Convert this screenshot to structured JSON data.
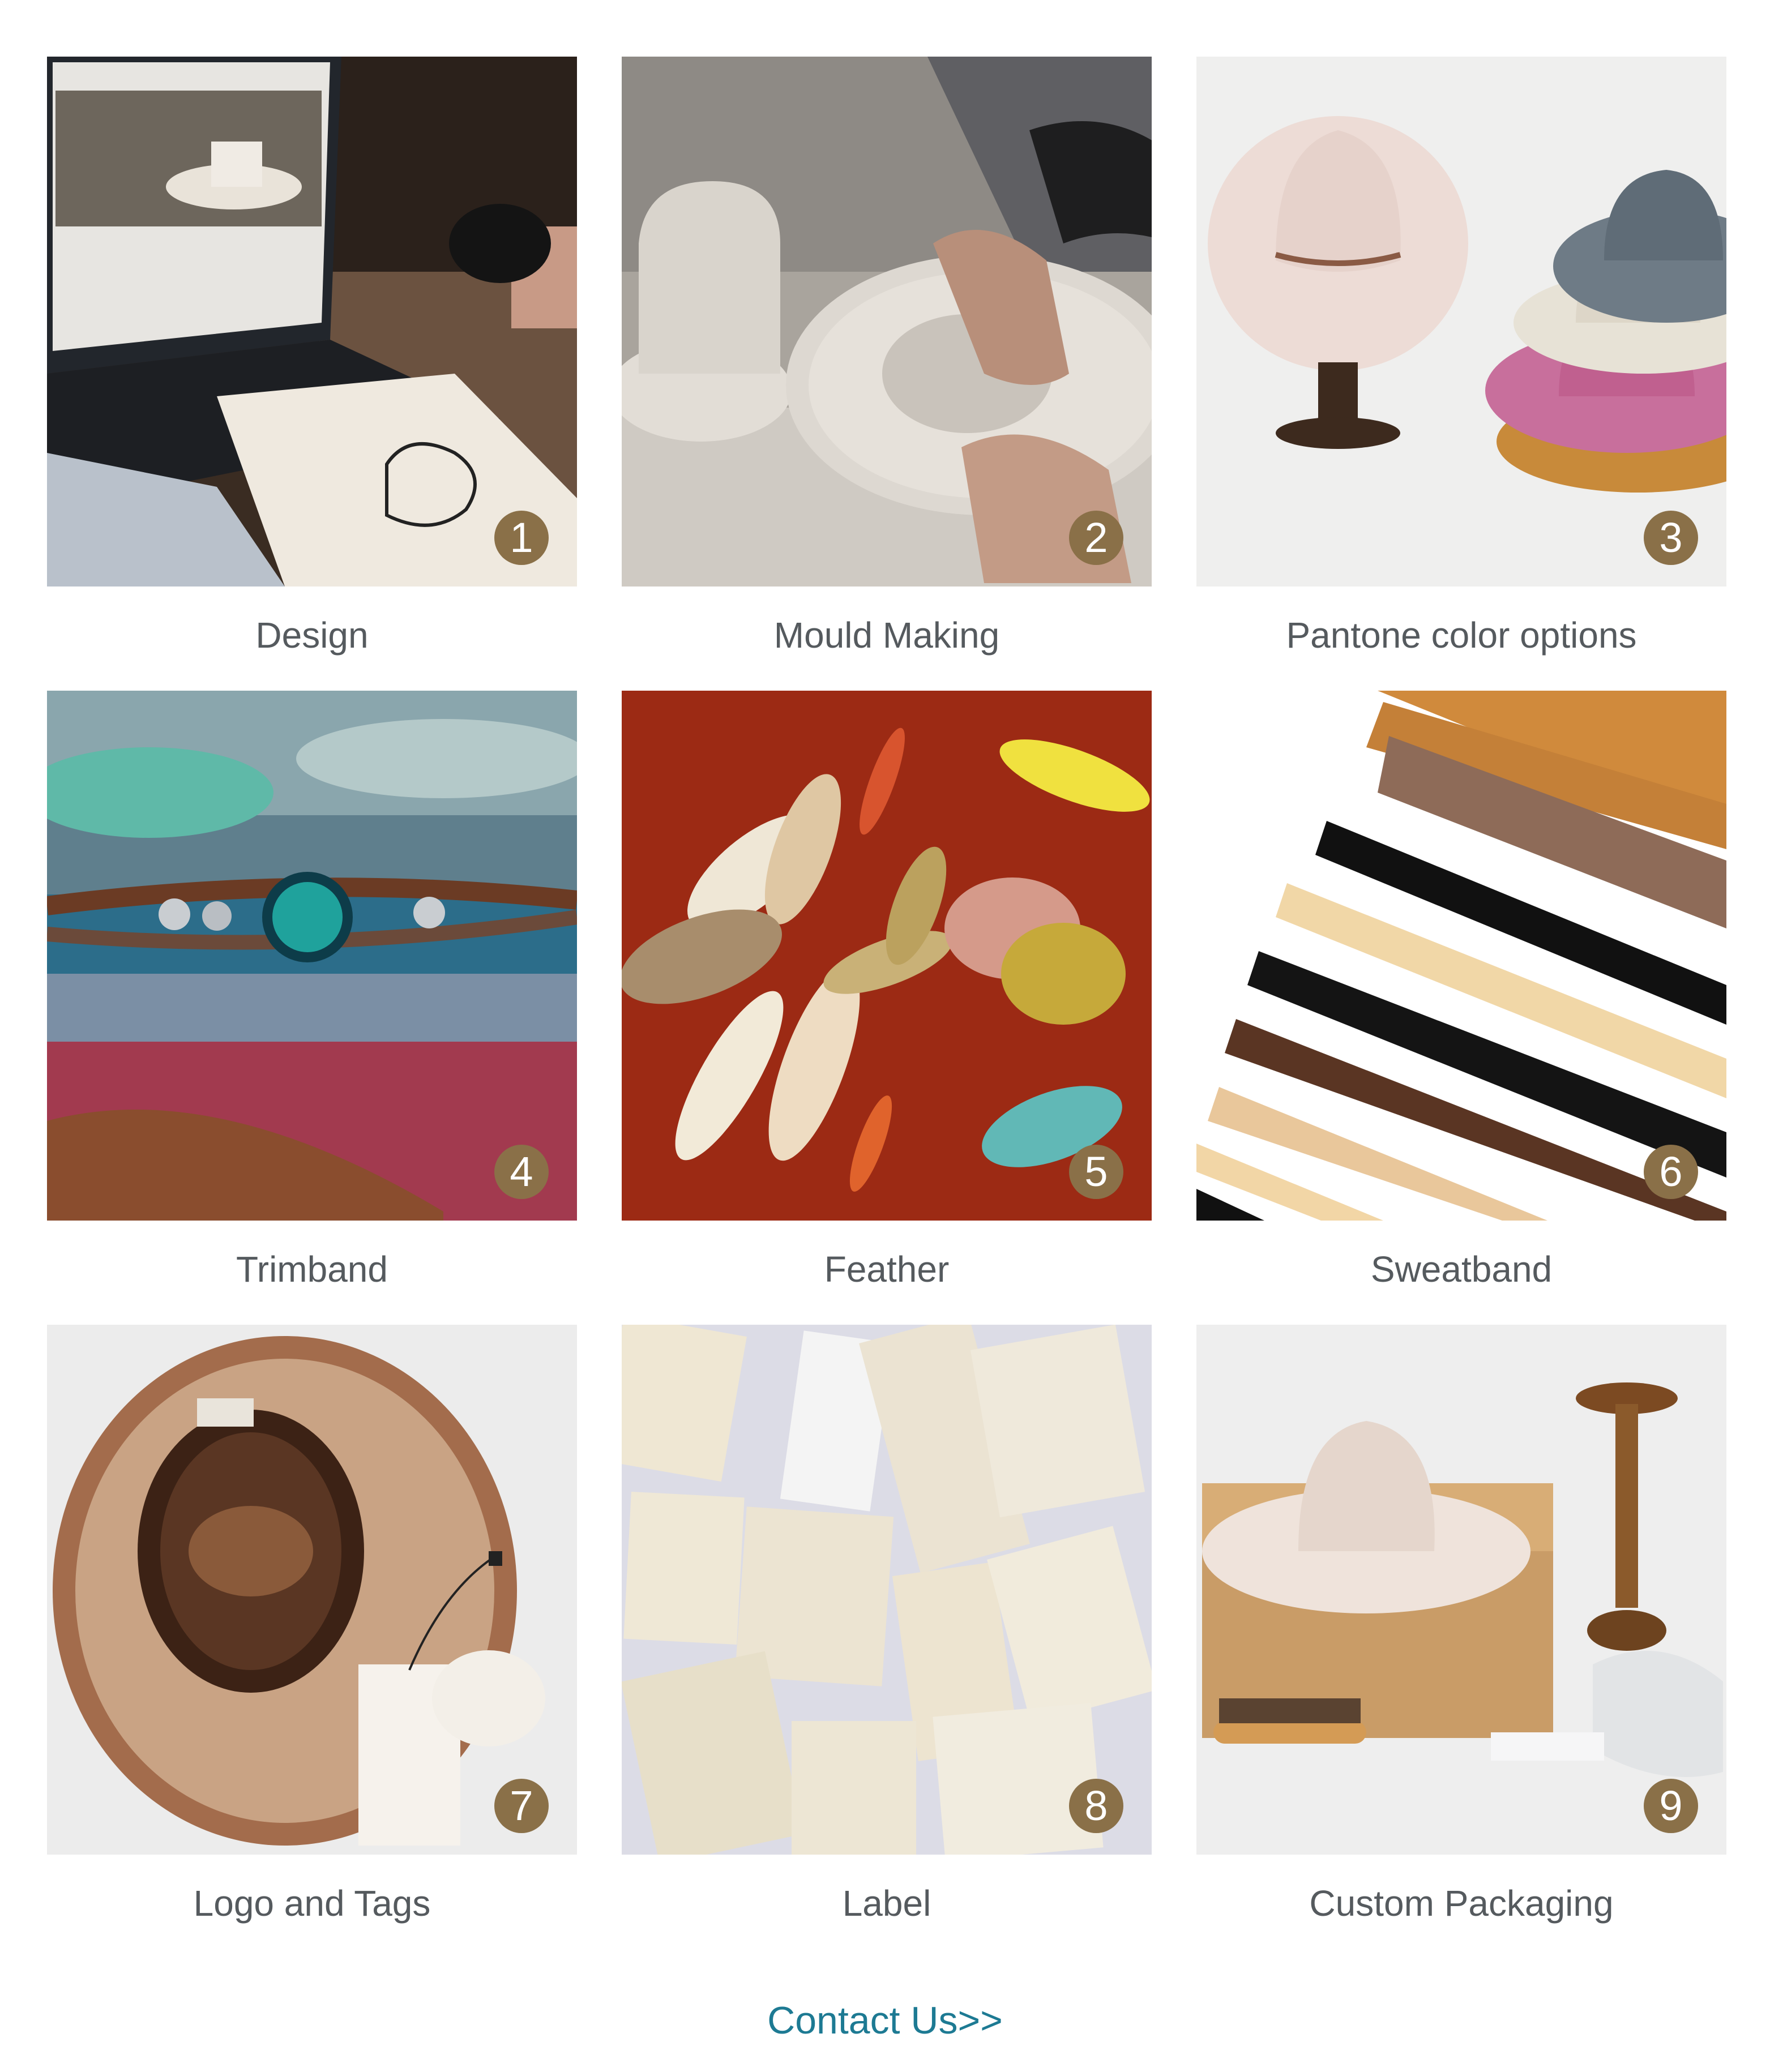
{
  "items": [
    {
      "number": "1",
      "label": "Design",
      "icon": "laptop-sketch-photo"
    },
    {
      "number": "2",
      "label": "Mould Making",
      "icon": "hat-mould-photo"
    },
    {
      "number": "3",
      "label": "Pantone color options",
      "icon": "colored-hats-photo"
    },
    {
      "number": "4",
      "label": "Trimband",
      "icon": "leather-trimband-photo"
    },
    {
      "number": "5",
      "label": "Feather",
      "icon": "feathers-photo"
    },
    {
      "number": "6",
      "label": "Sweatband",
      "icon": "sweatband-strips-photo"
    },
    {
      "number": "7",
      "label": "Logo and Tags",
      "icon": "hat-inside-tags-photo"
    },
    {
      "number": "8",
      "label": "Label",
      "icon": "woven-labels-photo"
    },
    {
      "number": "9",
      "label": "Custom Packaging",
      "icon": "hat-box-photo"
    }
  ],
  "contact": {
    "label": "Contact Us>>"
  },
  "colors": {
    "badge": "#8a7048",
    "caption": "#555a5e",
    "link": "#1d7a93"
  }
}
